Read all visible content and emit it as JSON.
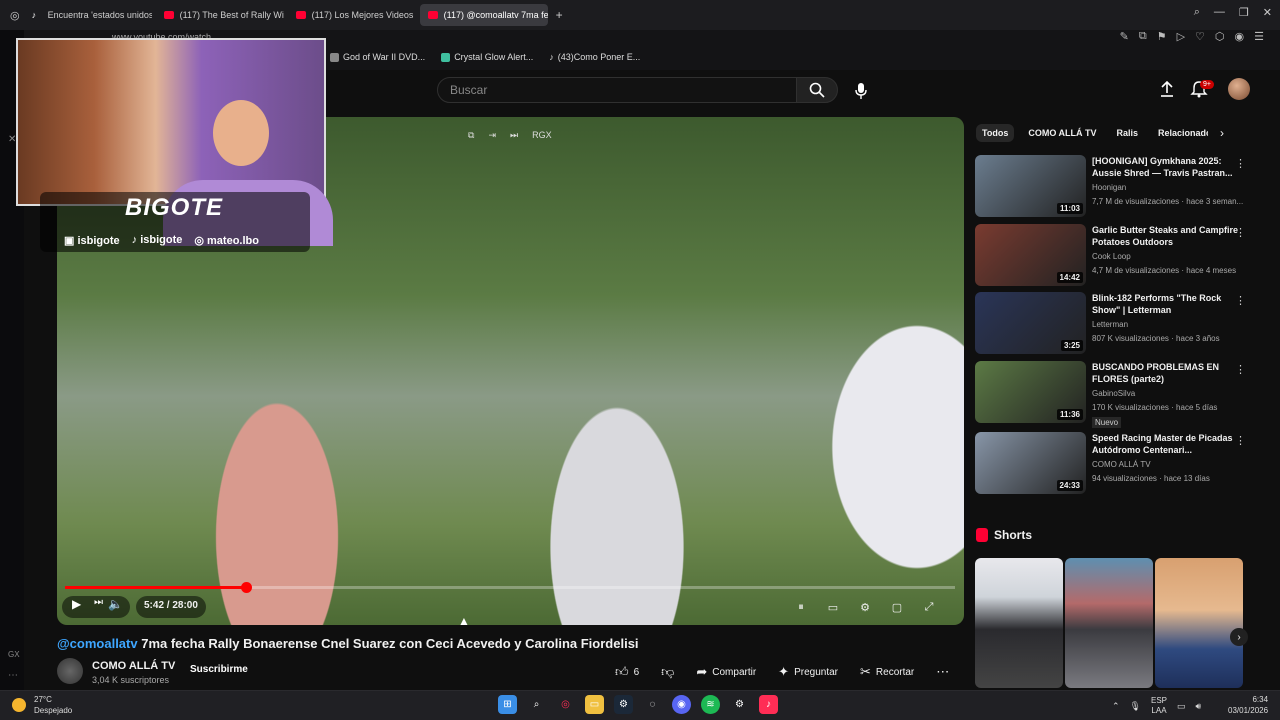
{
  "browser": {
    "tabs": [
      {
        "label": "Encuentra 'estados unidos"
      },
      {
        "label": "(117) The Best of Rally Wi"
      },
      {
        "label": "(117) Los Mejores Videos"
      },
      {
        "label": "(117) @comoallatv 7ma fe"
      }
    ],
    "new_tab": "+",
    "url": "www.youtube.com/watch",
    "bookmarks": [
      {
        "label": "God of War II DVD..."
      },
      {
        "label": "Crystal Glow Alert..."
      },
      {
        "label": "(43)Como Poner E..."
      }
    ]
  },
  "youtube": {
    "search_placeholder": "Buscar",
    "notifications_badge": "9+"
  },
  "stream_overlay": {
    "brand": "BIGOTE",
    "handles": [
      "isbigote",
      "isbigote",
      "mateo.lbo"
    ]
  },
  "player": {
    "top_label": "RGX",
    "time": "5:42 / 28:00",
    "progress": 0.2036
  },
  "video": {
    "handle": "@comoallatv",
    "title": "7ma fecha Rally Bonaerense Cnel Suarez con Ceci Acevedo y Carolina Fiordelisi",
    "channel": "COMO ALLÁ TV",
    "subscribers": "3,04 K suscriptores",
    "subscribe_label": "Suscribirme",
    "likes": "6",
    "share_label": "Compartir",
    "ask_label": "Preguntar",
    "clip_label": "Recortar"
  },
  "sidebar": {
    "chips": [
      "Todos",
      "COMO ALLÁ TV",
      "Ralis",
      "Relacionado"
    ],
    "recommendations": [
      {
        "title": "[HOONIGAN] Gymkhana 2025: Aussie Shred — Travis Pastran...",
        "channel": "Hoonigan",
        "meta": "7,7 M de visualizaciones · hace 3 seman...",
        "duration": "11:03",
        "color": "#6b7d8f"
      },
      {
        "title": "Garlic Butter Steaks and Campfire Potatoes Outdoors",
        "channel": "Cook Loop",
        "meta": "4,7 M de visualizaciones · hace 4 meses",
        "duration": "14:42",
        "color": "#7a3b30"
      },
      {
        "title": "Blink-182 Performs \"The Rock Show\" | Letterman",
        "channel": "Letterman",
        "meta": "807 K visualizaciones · hace 3 años",
        "duration": "3:25",
        "color": "#2a3558"
      },
      {
        "title": "BUSCANDO PROBLEMAS EN FLORES (parte2)",
        "channel": "GabinoSilva",
        "meta": "170 K visualizaciones · hace 5 días",
        "duration": "11:36",
        "color": "#5c7a45",
        "badge": "Nuevo"
      },
      {
        "title": "Speed Racing Master de Picadas Autódromo Centenari...",
        "channel": "COMO ALLÁ TV",
        "meta": "94 visualizaciones · hace 13 días",
        "duration": "24:33",
        "color": "#8896a8"
      }
    ],
    "shorts_title": "Shorts"
  },
  "taskbar": {
    "temperature": "27°C",
    "weather": "Despejado",
    "lang_top": "ESP",
    "lang_bottom": "LAA",
    "time": "6:34",
    "date": "03/01/2026"
  },
  "colors": {
    "accent": "#ff0000",
    "link": "#3ea6ff"
  }
}
